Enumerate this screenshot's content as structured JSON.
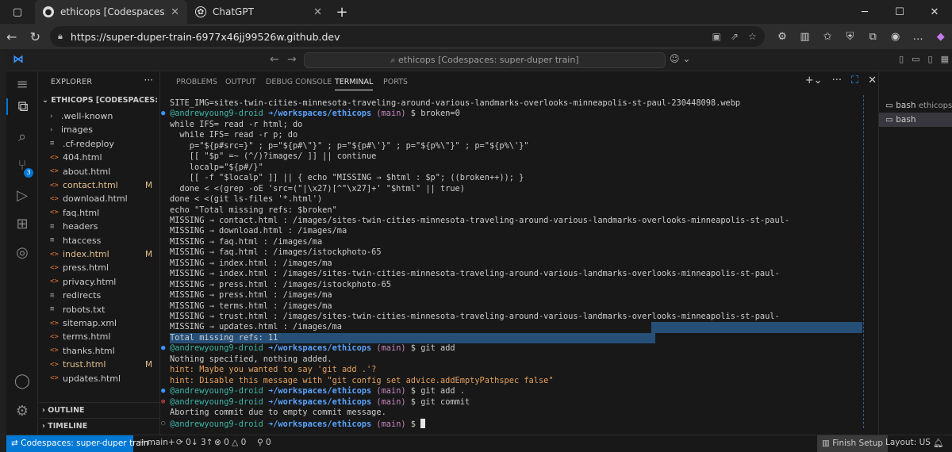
{
  "browser": {
    "tabs": [
      {
        "label": "ethicops [Codespaces: super-dupe",
        "active": true
      },
      {
        "label": "ChatGPT",
        "active": false
      }
    ],
    "url": "https://super-duper-train-6977x46jj99526w.github.dev"
  },
  "vscode": {
    "command_center": "ethicops [Codespaces: super-duper train]",
    "explorer": {
      "title": "EXPLORER",
      "root": "ETHICOPS [CODESPACES: SUP...",
      "items": [
        {
          "name": ".well-known",
          "type": "folder",
          "status": ""
        },
        {
          "name": "images",
          "type": "folder",
          "status": ""
        },
        {
          "name": ".cf-redeploy",
          "type": "file",
          "status": ""
        },
        {
          "name": "404.html",
          "type": "html",
          "status": ""
        },
        {
          "name": "about.html",
          "type": "html",
          "status": ""
        },
        {
          "name": "contact.html",
          "type": "html",
          "status": "M"
        },
        {
          "name": "download.html",
          "type": "html",
          "status": ""
        },
        {
          "name": "faq.html",
          "type": "html",
          "status": ""
        },
        {
          "name": "headers",
          "type": "file",
          "status": ""
        },
        {
          "name": "htaccess",
          "type": "file",
          "status": ""
        },
        {
          "name": "index.html",
          "type": "html",
          "status": "M"
        },
        {
          "name": "press.html",
          "type": "html",
          "status": ""
        },
        {
          "name": "privacy.html",
          "type": "html",
          "status": ""
        },
        {
          "name": "redirects",
          "type": "file",
          "status": ""
        },
        {
          "name": "robots.txt",
          "type": "file",
          "status": ""
        },
        {
          "name": "sitemap.xml",
          "type": "xml",
          "status": ""
        },
        {
          "name": "terms.html",
          "type": "html",
          "status": ""
        },
        {
          "name": "thanks.html",
          "type": "html",
          "status": ""
        },
        {
          "name": "trust.html",
          "type": "html",
          "status": "M"
        },
        {
          "name": "updates.html",
          "type": "html",
          "status": ""
        }
      ],
      "outline": "OUTLINE",
      "timeline": "TIMELINE"
    },
    "source_control_badge": "3",
    "panel_tabs": [
      "PROBLEMS",
      "OUTPUT",
      "DEBUG CONSOLE",
      "TERMINAL",
      "PORTS"
    ],
    "terminal_list": [
      {
        "label": "bash",
        "desc": "ethicops"
      },
      {
        "label": "bash",
        "desc": ""
      }
    ],
    "terminal": {
      "lines": [
        {
          "kind": "out",
          "text": "SITE_IMG=sites-twin-cities-minnesota-traveling-around-various-landmarks-overlooks-minneapolis-st-paul-230448098.webp"
        },
        {
          "kind": "prompt",
          "dot": "blue",
          "user": "@andrewyoung9-droid",
          "path": "➜/workspaces/ethicops",
          "branch": "(main)",
          "cmd": "$ broken=0"
        },
        {
          "kind": "out",
          "text": "while IFS= read -r html; do"
        },
        {
          "kind": "out",
          "text": "  while IFS= read -r p; do"
        },
        {
          "kind": "out",
          "text": "    p=\"${p#src=}\" ; p=\"${p#\\\"}\" ; p=\"${p#\\'}\" ; p=\"${p%\\\"}\" ; p=\"${p%\\'}\""
        },
        {
          "kind": "out",
          "text": "    [[ \"$p\" =~ (^/)?images/ ]] || continue"
        },
        {
          "kind": "out",
          "text": "    localp=\"${p#/}\""
        },
        {
          "kind": "out",
          "text": "    [[ -f \"$localp\" ]] || { echo \"MISSING → $html : $p\"; ((broken++)); }"
        },
        {
          "kind": "out",
          "text": "  done < <(grep -oE 'src=(\"|\\x27)[^\"\\x27]+' \"$html\" || true)"
        },
        {
          "kind": "out",
          "text": "done < <(git ls-files '*.html')"
        },
        {
          "kind": "out",
          "text": "echo \"Total missing refs: $broken\""
        },
        {
          "kind": "out",
          "text": "MISSING → contact.html : /images/sites-twin-cities-minnesota-traveling-around-various-landmarks-overlooks-minneapolis-st-paul-"
        },
        {
          "kind": "out",
          "text": "MISSING → download.html : /images/ma"
        },
        {
          "kind": "out",
          "text": "MISSING → faq.html : /images/ma"
        },
        {
          "kind": "out",
          "text": "MISSING → faq.html : /images/istockphoto-65"
        },
        {
          "kind": "out",
          "text": "MISSING → index.html : /images/ma"
        },
        {
          "kind": "out",
          "text": "MISSING → index.html : /images/sites-twin-cities-minnesota-traveling-around-various-landmarks-overlooks-minneapolis-st-paul-"
        },
        {
          "kind": "out",
          "text": "MISSING → press.html : /images/istockphoto-65"
        },
        {
          "kind": "out",
          "text": "MISSING → press.html : /images/ma"
        },
        {
          "kind": "out",
          "text": "MISSING → terms.html : /images/ma"
        },
        {
          "kind": "out",
          "text": "MISSING → trust.html : /images/sites-twin-cities-minnesota-traveling-around-various-landmarks-overlooks-minneapolis-st-paul-"
        },
        {
          "kind": "out",
          "text": "MISSING → updates.html : /images/ma",
          "hl": "partial"
        },
        {
          "kind": "out",
          "text": "Total missing refs: 11",
          "hl": "full"
        },
        {
          "kind": "prompt",
          "dot": "blue",
          "user": "@andrewyoung9-droid",
          "path": "➜/workspaces/ethicops",
          "branch": "(main)",
          "cmd": "$ git add"
        },
        {
          "kind": "out",
          "text": "Nothing specified, nothing added."
        },
        {
          "kind": "hint",
          "text": "hint: Maybe you wanted to say 'git add .'?"
        },
        {
          "kind": "hint",
          "text": "hint: Disable this message with \"git config set advice.addEmptyPathspec false\""
        },
        {
          "kind": "prompt",
          "dot": "blue",
          "user": "@andrewyoung9-droid",
          "path": "➜/workspaces/ethicops",
          "branch": "(main)",
          "cmd": "$ git add ."
        },
        {
          "kind": "prompt",
          "dot": "red",
          "user": "@andrewyoung9-droid",
          "path": "➜/workspaces/ethicops",
          "branch": "(main)",
          "cmd": "$ git commit"
        },
        {
          "kind": "out",
          "text": "Aborting commit due to empty commit message."
        },
        {
          "kind": "prompt",
          "dot": "gray",
          "user": "@andrewyoung9-droid",
          "path": "➜/workspaces/ethicops",
          "branch": "(main)",
          "cmd": "$ ",
          "cursor": true
        }
      ]
    },
    "status": {
      "remote": "Codespaces: super-duper train",
      "branch": "main+",
      "sync": "0↓ 3↑",
      "problems": "0",
      "warnings": "0",
      "ports": "0",
      "finish": "Finish Setup",
      "layout": "Layout: US"
    }
  }
}
